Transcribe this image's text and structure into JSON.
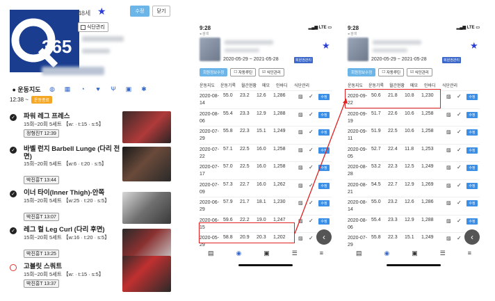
{
  "left": {
    "age": "48세",
    "edit_label": "수정",
    "close_label": "닫기",
    "diet_label": "식단관리",
    "tabs": {
      "active": "운동지도"
    },
    "time": "12:38 ~",
    "status_badge": "운동종료",
    "exercises": [
      {
        "name": "파워 레그 프레스",
        "spec": "15회~20회 5세트 【w: · t:15 · s:5】",
        "trainer": "정형진T 12:39",
        "done": true
      },
      {
        "name": "바벨 런지 Barbell Lunge (다리 전면)",
        "spec": "15회~20회 5세트 【w:6 · t:20 · s:5】",
        "trainer": "박진흥T 13:44",
        "done": true
      },
      {
        "name": "이너 타이(Inner Thigh)-안쪽",
        "spec": "15회~20회 5세트 【w:25 · t:20 · s:5】",
        "trainer": "박진흥T 13:07",
        "done": true
      },
      {
        "name": "레그 컬 Leg Curl (다리 후면)",
        "spec": "15회~20회 5세트 【w:16 · t:20 · s:5】",
        "trainer": "박진흥T 13:25",
        "done": true
      },
      {
        "name": "고블릿 스쿼트",
        "spec": "15회~20회 5세트 【w: · t:15 · s:5】",
        "trainer": "박진흥T 13:37",
        "done": false
      }
    ]
  },
  "phone1": {
    "time": "9:28",
    "carrier": "◂ 검색",
    "signal": "LTE",
    "period": "2020-05-29 ~ 2021-05-28",
    "member_badge": "회원권관리",
    "buttons": [
      "회원정보수정",
      "자동루틴",
      "식단관리"
    ],
    "headers": [
      "운동지도",
      "운동기록",
      "월간현황",
      "메모",
      "인바디",
      "식단관리"
    ],
    "rows": [
      {
        "date": "2020-08-14",
        "v1": "55.0",
        "v2": "23.2",
        "v3": "12.6",
        "v4": "1,286"
      },
      {
        "date": "2020-08-06",
        "v1": "55.4",
        "v2": "23.3",
        "v3": "12.9",
        "v4": "1,288"
      },
      {
        "date": "2020-07-29",
        "v1": "55.8",
        "v2": "22.3",
        "v3": "15.1",
        "v4": "1,249"
      },
      {
        "date": "2020-07-22",
        "v1": "57.1",
        "v2": "22.5",
        "v3": "16.0",
        "v4": "1,258"
      },
      {
        "date": "2020-07-17",
        "v1": "57.0",
        "v2": "22.5",
        "v3": "16.0",
        "v4": "1,258"
      },
      {
        "date": "2020-07-09",
        "v1": "57.3",
        "v2": "22.7",
        "v3": "16.0",
        "v4": "1,262"
      },
      {
        "date": "2020-06-29",
        "v1": "57.9",
        "v2": "21.7",
        "v3": "18.1",
        "v4": "1,230"
      },
      {
        "date": "2020-06-15",
        "v1": "59.6",
        "v2": "22.2",
        "v3": "19.0",
        "v4": "1,247"
      },
      {
        "date": "2020-05-29",
        "v1": "58.8",
        "v2": "20.9",
        "v3": "20.3",
        "v4": "1,202"
      }
    ],
    "row_button": "수정",
    "nav": [
      "▤",
      "◉",
      "▣",
      "☰",
      "≡"
    ]
  },
  "phone2": {
    "time": "9:28",
    "carrier": "◂ 검색",
    "signal": "LTE",
    "period": "2020-05-29 ~ 2021-05-28",
    "member_badge": "회원권관리",
    "buttons": [
      "회원정보수정",
      "자동루틴",
      "식단관리"
    ],
    "headers": [
      "운동지도",
      "운동기록",
      "월간현황",
      "메모",
      "인바디",
      "식단관리"
    ],
    "rows": [
      {
        "date": "2020-09-22",
        "v1": "50.6",
        "v2": "21.8",
        "v3": "10.8",
        "v4": "1,230"
      },
      {
        "date": "2020-09-19",
        "v1": "51.7",
        "v2": "22.6",
        "v3": "10.6",
        "v4": "1,258"
      },
      {
        "date": "2020-09-11",
        "v1": "51.9",
        "v2": "22.5",
        "v3": "10.6",
        "v4": "1,258"
      },
      {
        "date": "2020-09-05",
        "v1": "52.7",
        "v2": "22.4",
        "v3": "11.8",
        "v4": "1,253"
      },
      {
        "date": "2020-08-28",
        "v1": "53.2",
        "v2": "22.3",
        "v3": "12.5",
        "v4": "1,249"
      },
      {
        "date": "2020-08-21",
        "v1": "54.5",
        "v2": "22.7",
        "v3": "12.9",
        "v4": "1,269"
      },
      {
        "date": "2020-08-14",
        "v1": "55.0",
        "v2": "23.2",
        "v3": "12.6",
        "v4": "1,286"
      },
      {
        "date": "2020-08-06",
        "v1": "55.4",
        "v2": "23.3",
        "v3": "12.9",
        "v4": "1,288"
      },
      {
        "date": "2020-07-29",
        "v1": "55.8",
        "v2": "22.3",
        "v3": "15.1",
        "v4": "1,249"
      }
    ],
    "row_button": "수정",
    "nav": [
      "▤",
      "◉",
      "▣",
      "☰",
      "≡"
    ]
  },
  "colors": {
    "accent": "#3a8ee6",
    "highlight": "#e02020",
    "star": "#2b3fd6",
    "orange": "#f5a623"
  }
}
